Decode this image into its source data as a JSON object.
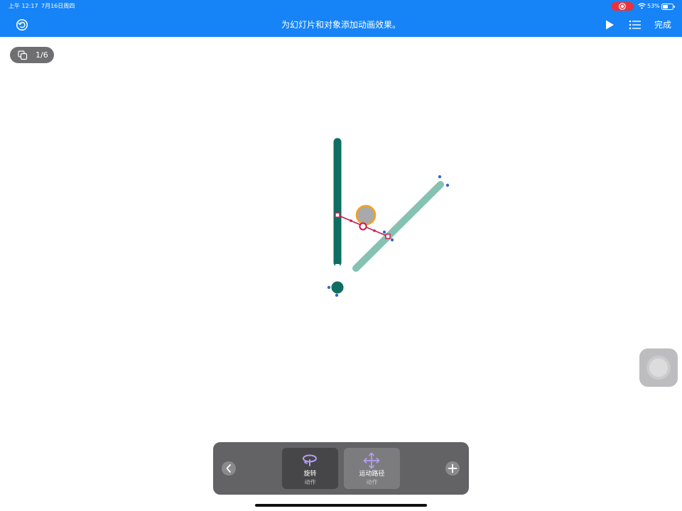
{
  "status_bar": {
    "time": "上午 12:17",
    "date": "7月16日周四",
    "battery": "53%"
  },
  "toolbar": {
    "title": "为幻灯片和对象添加动画效果。",
    "done_label": "完成"
  },
  "slide_counter": {
    "label": "1/6"
  },
  "animation_panel": {
    "effects": [
      {
        "label": "旋转",
        "sub_label": "动作",
        "icon": "rotate-icon"
      },
      {
        "label": "运动路径",
        "sub_label": "动作",
        "icon": "move-arrows-icon"
      }
    ]
  },
  "colors": {
    "toolbar_blue": "#1683f7",
    "bar_dark_green": "#0f6e62",
    "bar_light_green": "#85c2b1",
    "path_red": "#d0144a",
    "orange_ring": "#f5a11e",
    "handle_blue": "#2f6cc7",
    "effect_purple": "#b59cf2"
  }
}
